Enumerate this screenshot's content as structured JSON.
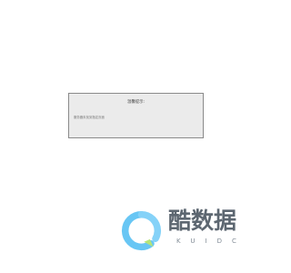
{
  "dialog": {
    "title": "温馨提示:",
    "message": "服务器未找到指定页面"
  },
  "watermark": {
    "brand_text": "酷数据",
    "brand_subtext": "KUIDC",
    "colors": {
      "ring": "#47baf2",
      "tail": "#a7df5b",
      "text": "#3a4653",
      "subtext": "#66727f"
    }
  }
}
